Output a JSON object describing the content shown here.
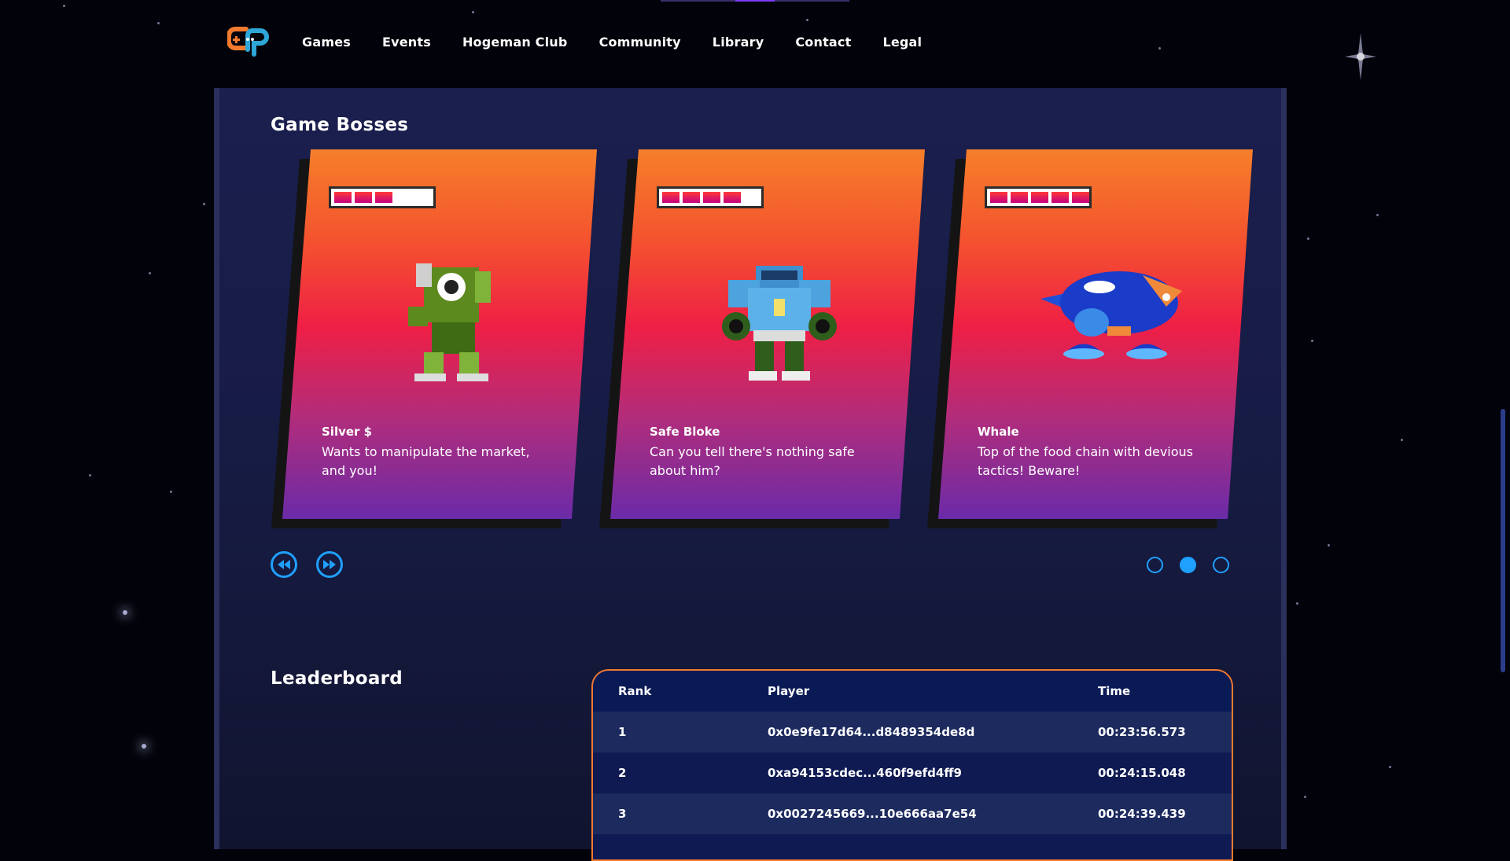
{
  "nav": {
    "items": [
      "Games",
      "Events",
      "Hogeman Club",
      "Community",
      "Library",
      "Contact",
      "Legal"
    ]
  },
  "bosses": {
    "title": "Game Bosses",
    "cards": [
      {
        "name": "Silver $",
        "description": "Wants to manipulate the market, and you!",
        "health_bars": 3
      },
      {
        "name": "Safe Bloke",
        "description": "Can you tell there's nothing safe about him?",
        "health_bars": 4
      },
      {
        "name": "Whale",
        "description": "Top of the food chain with devious tactics! Beware!",
        "health_bars": 5
      }
    ],
    "controls": {
      "prev_icon": "rewind-icon",
      "next_icon": "fast-forward-icon"
    },
    "pagination": {
      "count": 3,
      "active_index": 1
    }
  },
  "leaderboard": {
    "title": "Leaderboard",
    "columns": [
      "Rank",
      "Player",
      "Time"
    ],
    "rows": [
      {
        "rank": "1",
        "player": "0x0e9fe17d64...d8489354de8d",
        "time": "00:23:56.573"
      },
      {
        "rank": "2",
        "player": "0xa94153cdec...460f9efd4ff9",
        "time": "00:24:15.048"
      },
      {
        "rank": "3",
        "player": "0x0027245669...10e666aa7e54",
        "time": "00:24:39.439"
      }
    ]
  },
  "colors": {
    "accent_blue": "#1fa0ff",
    "accent_orange": "#f27a2f",
    "panel": "#1a1f4e"
  }
}
